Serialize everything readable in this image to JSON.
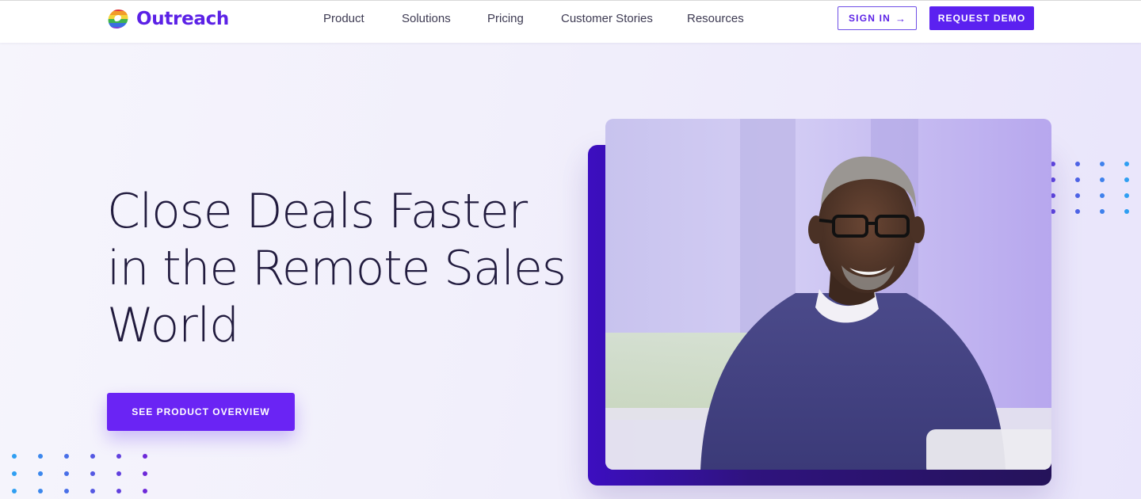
{
  "header": {
    "logo_text": "Outreach",
    "nav": [
      "Product",
      "Solutions",
      "Pricing",
      "Customer Stories",
      "Resources"
    ],
    "signin_label": "SIGN IN",
    "signin_icon": "arrow-right-icon",
    "demo_label": "REQUEST DEMO"
  },
  "hero": {
    "headline": [
      "Close Deals Faster",
      "in the Remote Sales",
      "World"
    ],
    "cta_label": "SEE PRODUCT OVERVIEW",
    "image_icon": "smiling-man-photo"
  },
  "colors": {
    "brand": "#5b21e6",
    "cta": "#6a24f4",
    "headline": "#211b3e",
    "dot_blue": "#2f9ff2",
    "dot_purple": "#6d28d9"
  }
}
